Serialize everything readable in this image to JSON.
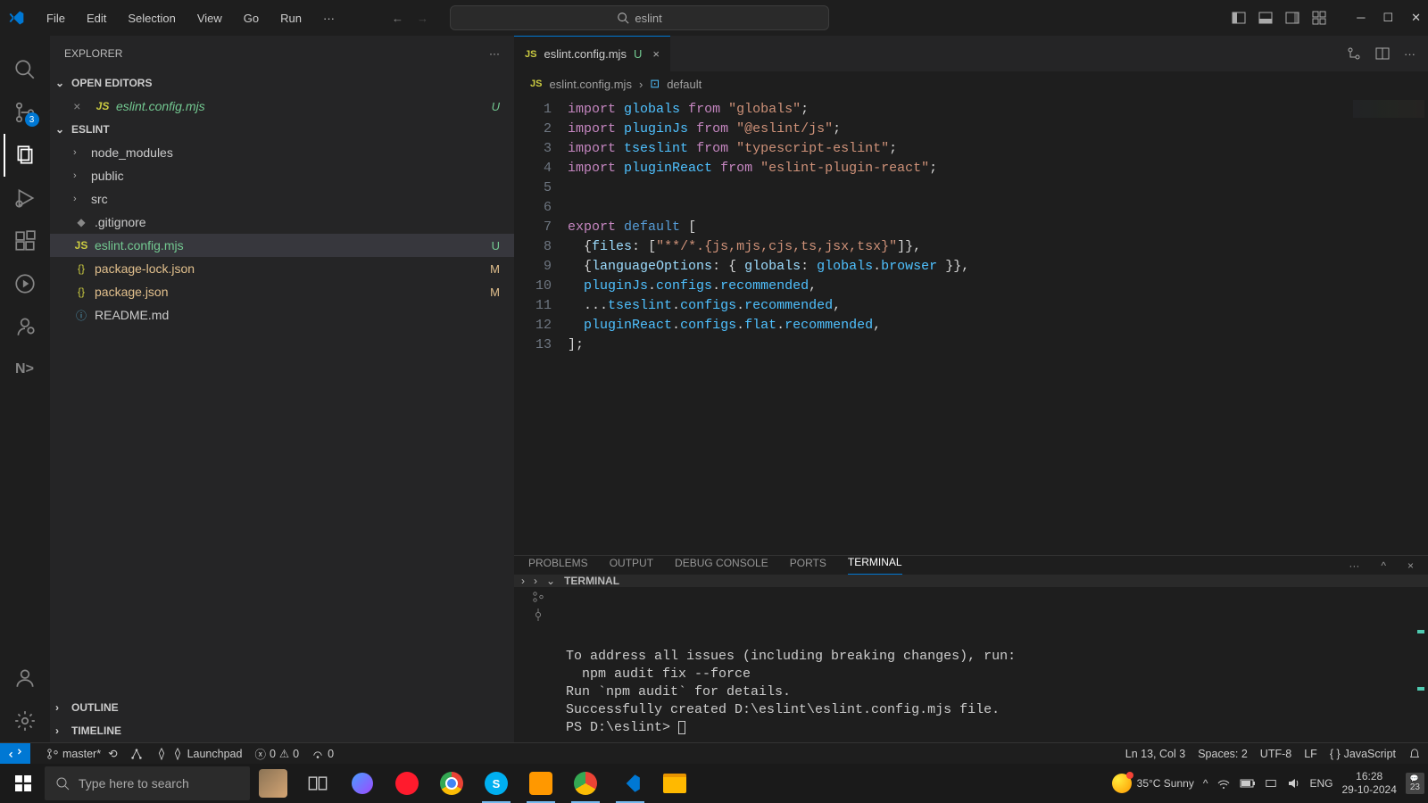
{
  "menubar": [
    "File",
    "Edit",
    "Selection",
    "View",
    "Go",
    "Run"
  ],
  "search": {
    "value": "eslint"
  },
  "explorer": {
    "title": "EXPLORER",
    "openEditors": {
      "title": "OPEN EDITORS"
    },
    "openEditorItems": [
      {
        "name": "eslint.config.mjs",
        "badge": "U",
        "gitClass": "git-untracked",
        "icon": "JS"
      }
    ],
    "projectName": "ESLINT",
    "tree": [
      {
        "name": "node_modules",
        "folder": true
      },
      {
        "name": "public",
        "folder": true
      },
      {
        "name": "src",
        "folder": true
      },
      {
        "name": ".gitignore",
        "icon": "◆",
        "iconColor": "#888"
      },
      {
        "name": "eslint.config.mjs",
        "icon": "JS",
        "badge": "U",
        "gitClass": "git-untracked",
        "selected": true
      },
      {
        "name": "package-lock.json",
        "icon": "{}",
        "badge": "M",
        "gitClass": "git-modified"
      },
      {
        "name": "package.json",
        "icon": "{}",
        "badge": "M",
        "gitClass": "git-modified"
      },
      {
        "name": "README.md",
        "icon": "ⓘ",
        "iconColor": "#519aba"
      }
    ],
    "outline": "OUTLINE",
    "timeline": "TIMELINE"
  },
  "scm_badge": "3",
  "tab": {
    "name": "eslint.config.mjs",
    "badge": "U"
  },
  "breadcrumb": {
    "file": "eslint.config.mjs",
    "symbol": "default"
  },
  "code_lines": 13,
  "panel": {
    "tabs": [
      "PROBLEMS",
      "OUTPUT",
      "DEBUG CONSOLE",
      "PORTS",
      "TERMINAL"
    ],
    "active": "TERMINAL",
    "subheader": "TERMINAL",
    "terminal_lines": [
      "To address all issues (including breaking changes), run:",
      "  npm audit fix --force",
      "",
      "Run `npm audit` for details.",
      "Successfully created D:\\eslint\\eslint.config.mjs file.",
      "PS D:\\eslint> "
    ]
  },
  "statusbar": {
    "branch": "master*",
    "launchpad": "Launchpad",
    "errors": "0",
    "warnings": "0",
    "ports": "0",
    "ln_col": "Ln 13, Col 3",
    "spaces": "Spaces: 2",
    "encoding": "UTF-8",
    "eol": "LF",
    "lang": "JavaScript"
  },
  "taskbar": {
    "search_placeholder": "Type here to search",
    "weather": "35°C  Sunny",
    "lang": "ENG",
    "time": "16:28",
    "date": "29-10-2024",
    "notif": "23"
  }
}
